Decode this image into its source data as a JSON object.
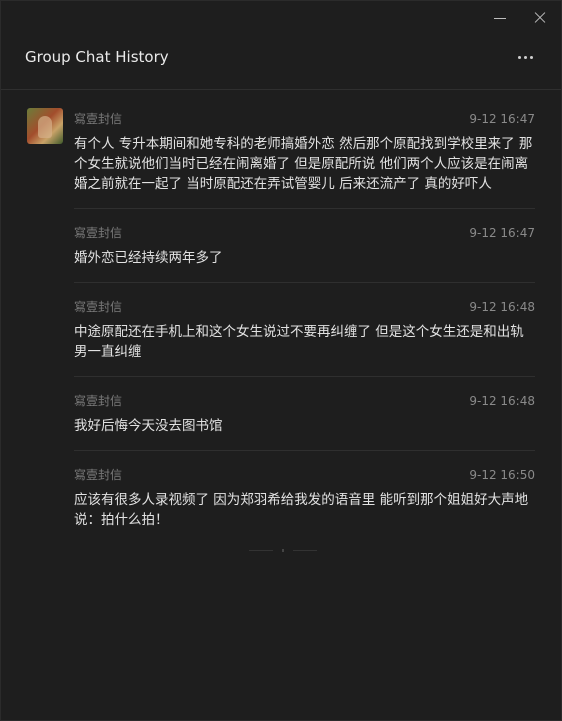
{
  "header": {
    "title": "Group Chat History"
  },
  "messages": [
    {
      "sender": "寫壹封信",
      "time": "9-12 16:47",
      "text": "有个人 专升本期间和她专科的老师搞婚外恋 然后那个原配找到学校里来了 那个女生就说他们当时已经在闹离婚了 但是原配所说 他们两个人应该是在闹离婚之前就在一起了 当时原配还在弄试管婴儿 后来还流产了 真的好吓人"
    },
    {
      "sender": "寫壹封信",
      "time": "9-12 16:47",
      "text": "婚外恋已经持续两年多了"
    },
    {
      "sender": "寫壹封信",
      "time": "9-12 16:48",
      "text": "中途原配还在手机上和这个女生说过不要再纠缠了 但是这个女生还是和出轨男一直纠缠"
    },
    {
      "sender": "寫壹封信",
      "time": "9-12 16:48",
      "text": "我好后悔今天没去图书馆"
    },
    {
      "sender": "寫壹封信",
      "time": "9-12 16:50",
      "text": "应该有很多人录视频了 因为郑羽希给我发的语音里 能听到那个姐姐好大声地说：拍什么拍！"
    }
  ]
}
